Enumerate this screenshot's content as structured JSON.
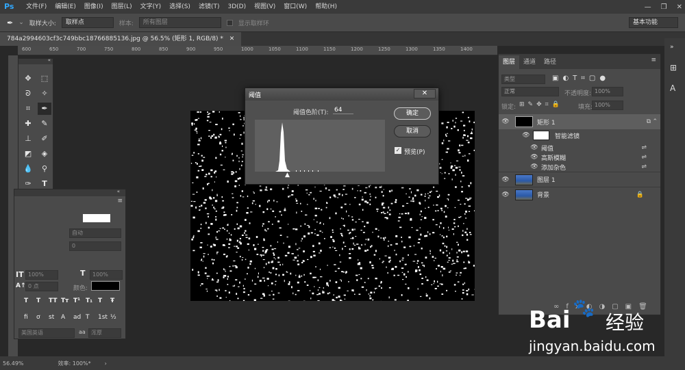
{
  "app": {
    "logo": "Ps"
  },
  "menu": [
    "文件(F)",
    "编辑(E)",
    "图像(I)",
    "图层(L)",
    "文字(Y)",
    "选择(S)",
    "滤镜(T)",
    "3D(D)",
    "视图(V)",
    "窗口(W)",
    "帮助(H)"
  ],
  "options": {
    "sample_size_label": "取样大小:",
    "sample_size_value": "取样点",
    "sample_label": "样本:",
    "sample_value": "所有图层",
    "show_ring": "显示取样环",
    "workspace": "基本功能"
  },
  "document": {
    "tab_title": "784a2994603cf3c749bbc18766885136.jpg @ 56.5% (矩形 1, RGB/8) *"
  },
  "ruler": {
    "ticks": [
      "600",
      "650",
      "700",
      "750",
      "800",
      "850",
      "900",
      "950",
      "1000",
      "1050",
      "1100",
      "1150",
      "1200",
      "1250",
      "1300",
      "1350",
      "1400"
    ]
  },
  "dialog": {
    "title": "阈值",
    "level_label": "阈值色阶(T):",
    "level_value": "64",
    "ok": "确定",
    "cancel": "取消",
    "preview": "预览(P)",
    "close": "✕"
  },
  "layers_panel": {
    "tabs": [
      "图层",
      "通道",
      "路径"
    ],
    "filter_kind": "类型",
    "blend_mode": "正常",
    "opacity_label": "不透明度:",
    "opacity_value": "100%",
    "lock_label": "锁定:",
    "fill_label": "填充:",
    "fill_value": "100%",
    "layers": [
      {
        "name": "矩形 1"
      },
      {
        "name": "智能滤镜"
      },
      {
        "name": "阈值"
      },
      {
        "name": "高斯模糊"
      },
      {
        "name": "添加杂色"
      },
      {
        "name": "图层 1"
      },
      {
        "name": "背景"
      }
    ]
  },
  "character_panel": {
    "size_placeholder": "自动",
    "tracking": "0",
    "scale_v": "100%",
    "scale_h": "100%",
    "baseline": "0 点",
    "color_label": "颜色:",
    "language": "美国英语",
    "aa_label": "aa",
    "aa_value": "浑厚",
    "styles": [
      "T",
      "T",
      "TT",
      "Tт",
      "T¹",
      "T₁",
      "T",
      "Ŧ"
    ],
    "ot": [
      "fi",
      "ơ",
      "st",
      "A",
      "ad",
      "T",
      "1st",
      "½"
    ]
  },
  "status": {
    "zoom": "56.49%",
    "efficiency": "效率: 100%*"
  },
  "watermark": {
    "brand": "Bai",
    "brand2": "经验",
    "url": "jingyan.baidu.com"
  },
  "colors": {
    "accent": "#31a8ff",
    "canvas": "#000000"
  }
}
